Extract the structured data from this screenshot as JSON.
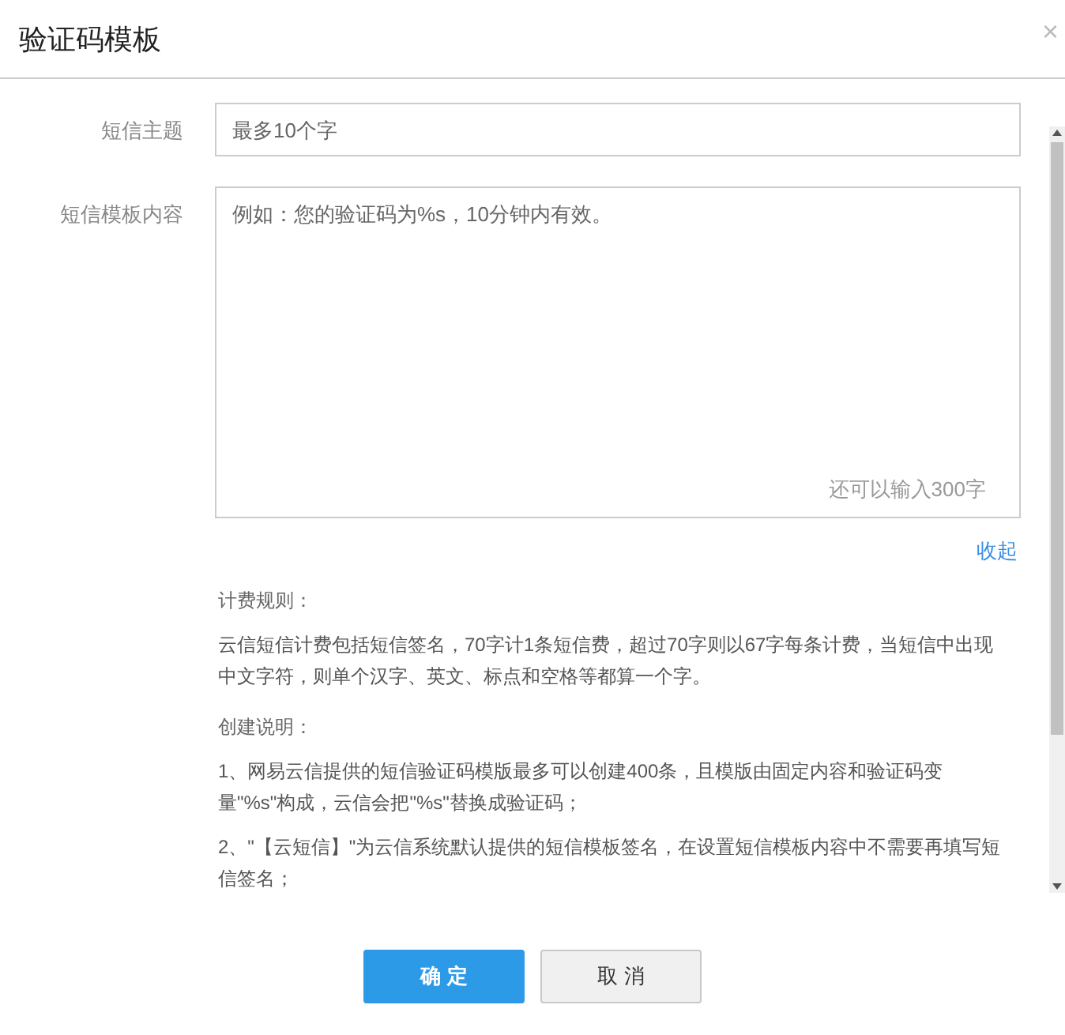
{
  "dialog": {
    "title": "验证码模板",
    "close": "×"
  },
  "form": {
    "fields": [
      {
        "kind": "input",
        "label": "短信主题",
        "placeholder": "最多10个字"
      },
      {
        "kind": "textarea",
        "label": "短信模板内容",
        "placeholder": "例如：您的验证码为%s，10分钟内有效。",
        "counter": "还可以输入300字"
      }
    ],
    "collapse_link": "收起"
  },
  "notes": [
    {
      "kind": "heading",
      "text": "计费规则："
    },
    {
      "kind": "paragraph",
      "text": "云信短信计费包括短信签名，70字计1条短信费，超过70字则以67字每条计费，当短信中出现中文字符，则单个汉字、英文、标点和空格等都算一个字。"
    },
    {
      "kind": "heading",
      "text": "创建说明："
    },
    {
      "kind": "paragraph",
      "text": "1、网易云信提供的短信验证码模版最多可以创建400条，且模版由固定内容和验证码变量\"%s\"构成，云信会把\"%s\"替换成验证码；"
    },
    {
      "kind": "paragraph",
      "text": "2、\"【云短信】\"为云信系统默认提供的短信模板签名，在设置短信模板内容中不需要再填写短信签名；"
    }
  ],
  "buttons": [
    {
      "kind": "primary",
      "label": "确 定"
    },
    {
      "kind": "secondary",
      "label": "取 消"
    }
  ]
}
